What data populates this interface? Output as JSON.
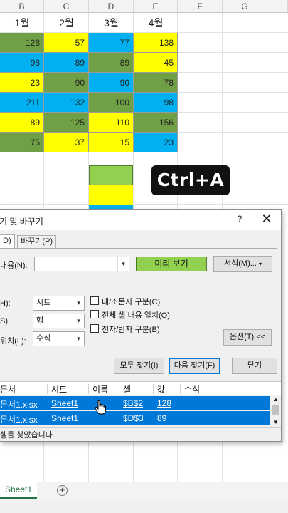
{
  "columns": [
    "B",
    "C",
    "D",
    "E",
    "F",
    "G"
  ],
  "month_headers": [
    "1월",
    "2월",
    "3월",
    "4월"
  ],
  "rows": [
    [
      128,
      57,
      77,
      138
    ],
    [
      98,
      89,
      89,
      45
    ],
    [
      23,
      90,
      90,
      78
    ],
    [
      211,
      132,
      100,
      98
    ],
    [
      89,
      125,
      110,
      156
    ],
    [
      75,
      37,
      15,
      23
    ]
  ],
  "row_colors": [
    [
      "#70a045",
      "#ffff00",
      "#00b0f0",
      "#ffff00"
    ],
    [
      "#00b0f0",
      "#00b0f0",
      "#70a045",
      "#ffff00"
    ],
    [
      "#ffff00",
      "#70a045",
      "#00b0f0",
      "#70a045"
    ],
    [
      "#00b0f0",
      "#00b0f0",
      "#70a045",
      "#00b0f0"
    ],
    [
      "#ffff00",
      "#70a045",
      "#ffff00",
      "#70a045"
    ],
    [
      "#70a045",
      "#ffff00",
      "#ffff00",
      "#00b0f0"
    ]
  ],
  "shortcut_badge": "Ctrl+A",
  "dialog": {
    "title": "찾기 및 바꾸기",
    "help": "?",
    "close": "✕",
    "tab_find": "D)",
    "tab_replace": "바꾸기(P)",
    "find_what_label": "내용(N):",
    "find_what_value": "",
    "preview": "미리 보기",
    "format_button": "서식(M)...",
    "within_label": "H):",
    "within_value": "시트",
    "search_label": "S):",
    "search_value": "행",
    "look_in_label": "위치(L):",
    "look_in_value": "수식",
    "match_case": "대/소문자 구분(C)",
    "match_entire": "전체 셀 내용 일치(O)",
    "match_byte": "전자/반자 구분(B)",
    "options_button": "옵션(T) <<",
    "find_all_button": "모두 찾기(I)",
    "find_next_button": "다음 찾기(F)",
    "close_button": "닫기",
    "results_headers": [
      "문서",
      "시트",
      "이름",
      "셀",
      "값",
      "수식"
    ],
    "results": [
      {
        "book": "문서1.xlsx",
        "sheet": "Sheet1",
        "name": "",
        "cell": "$B$2",
        "value": "128",
        "formula": ""
      },
      {
        "book": "문서1.xlsx",
        "sheet": "Sheet1",
        "name": "",
        "cell": "$D$3",
        "value": "89",
        "formula": ""
      }
    ],
    "status": "셀를 찾았습니다."
  },
  "sheet_tab": "Sheet1",
  "add_sheet": "+"
}
